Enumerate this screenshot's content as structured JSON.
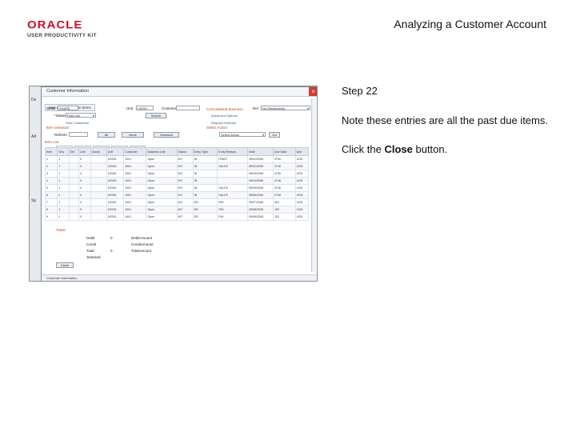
{
  "logo": {
    "brand": "ORACLE",
    "tagline": "USER PRODUCTIVITY KIT"
  },
  "header": {
    "title": "Analyzing a Customer Account"
  },
  "instructions": {
    "step": "Step 22",
    "note": "Note these entries are all the past due items.",
    "click_prefix": "Click the ",
    "click_target": "Close",
    "click_suffix": " button."
  },
  "screenshot": {
    "dialog_title": "Customer Information",
    "tabs": [
      "Item List",
      "Action Items"
    ],
    "fields": {
      "setid_label": "SetID",
      "setid_value": "SHARE",
      "unit_label": "Unit",
      "unit_value": "US001",
      "customer_label": "Customer",
      "customer_value": "Consolidated Business",
      "relationship_label": "Rel",
      "relationship_value": "No Relationship",
      "status_label": "*Status",
      "status_value": "Past Due",
      "search_button": "Search",
      "currency_label": "Currency",
      "currency_value": "USD",
      "action_label": "Select Action",
      "action_value": "Select Action"
    },
    "links": [
      "Advanced Options",
      "View Customers",
      "Request Overdue",
      "Select Action"
    ],
    "sections": {
      "item_selection": "Item Selection",
      "item_list": "Item List",
      "totals": "Totals"
    },
    "buttons": {
      "refresh": "Refresh",
      "all": "All",
      "none": "None",
      "deselect": "Deselect",
      "go": "Go",
      "close": "Close"
    },
    "grid_tabs": [
      "Detail 1",
      "Detail 2",
      "Detail 3",
      "Detail 4",
      "Detail 5"
    ],
    "grid_headers": [
      "Item",
      "Seq",
      "Sel",
      "Line",
      "Action",
      "Unit",
      "Customer",
      "Business Unit",
      "Status",
      "Entry Type",
      "Entry Reason",
      "Date",
      "Due Date",
      "Amt"
    ],
    "grid_rows": [
      [
        "1",
        "1",
        "",
        "0",
        "",
        "US001",
        "1001",
        "Open",
        "INT",
        "IN",
        "ITMDT",
        "05/01/2008",
        "4700",
        "USD"
      ],
      [
        "2",
        "1",
        "",
        "0",
        "",
        "US001",
        "1001",
        "Open",
        "INT",
        "IN",
        "SALES",
        "05/02/2008",
        "3746",
        "USD"
      ],
      [
        "3",
        "1",
        "",
        "0",
        "",
        "US001",
        "1001",
        "Open",
        "INT",
        "IN",
        "",
        "05/03/2008",
        "3746",
        "USD"
      ],
      [
        "4",
        "1",
        "",
        "0",
        "",
        "US001",
        "1001",
        "Open",
        "INT",
        "IN",
        "",
        "05/04/2008",
        "3746",
        "USD"
      ],
      [
        "5",
        "1",
        "",
        "0",
        "",
        "US001",
        "1001",
        "Open",
        "INT",
        "IN",
        "SALES",
        "05/05/2008",
        "3746",
        "USD"
      ],
      [
        "6",
        "1",
        "",
        "0",
        "",
        "US001",
        "1001",
        "Open",
        "INT",
        "IN",
        "SALES",
        "05/06/2008",
        "3746",
        "USD"
      ],
      [
        "7",
        "1",
        "",
        "0",
        "",
        "US001",
        "1001",
        "Open",
        "INT",
        "DR",
        "PAY",
        "05/07/2008",
        "451",
        "USD"
      ],
      [
        "8",
        "1",
        "",
        "0",
        "",
        "US001",
        "1001",
        "Open",
        "INT",
        "DR",
        "PAY",
        "05/08/2008",
        "109",
        "USD"
      ],
      [
        "9",
        "1",
        "",
        "0",
        "",
        "US001",
        "1001",
        "Open",
        "INT",
        "DR",
        "PAY",
        "05/09/2008",
        "103",
        "USD"
      ]
    ],
    "totals": [
      {
        "label": "Debit",
        "count": "0",
        "amt_label": "DebitAmount",
        "amount": ""
      },
      {
        "label": "Credit",
        "count": "",
        "amt_label": "CreditAmount",
        "amount": ""
      },
      {
        "label": "Total",
        "count": "0",
        "amt_label": "TotalAmount",
        "amount": ""
      },
      {
        "label": "Selected",
        "count": "",
        "amt_label": "",
        "amount": ""
      }
    ],
    "status_bar": "Customer Information"
  }
}
